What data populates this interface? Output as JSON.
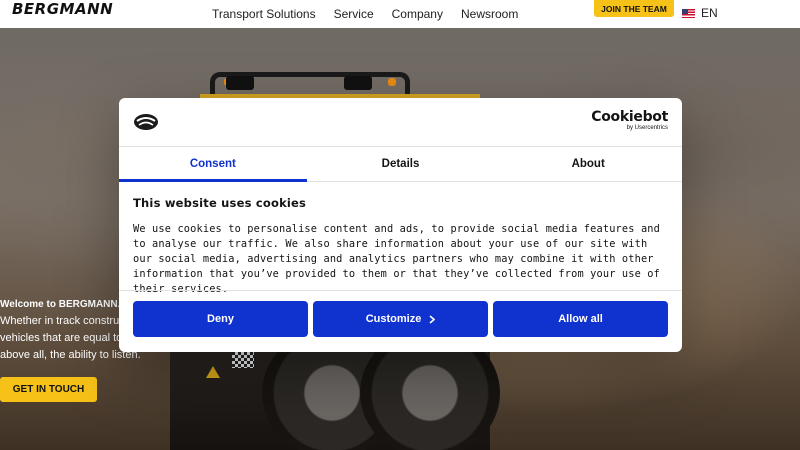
{
  "header": {
    "logo": "BERGMANN",
    "nav": [
      "Transport Solutions",
      "Service",
      "Company",
      "Newsroom"
    ],
    "join_label": "JOIN THE TEAM",
    "lang_label": "EN",
    "flag_icon": "us-flag-icon"
  },
  "hero": {
    "welcome": "Welcome to BERGMANN.",
    "line1": "Whether in track construc",
    "line2": "vehicles that are equal to",
    "line3": "above all, the ability to listen.",
    "cta_label": "GET IN TOUCH"
  },
  "cookie_dialog": {
    "brand_name": "Cookiebot",
    "brand_by": "by Usercentrics",
    "tabs": [
      "Consent",
      "Details",
      "About"
    ],
    "active_tab": "Consent",
    "title": "This website uses cookies",
    "text": "We use cookies to personalise content and ads, to provide social media features and to analyse our traffic. We also share information about your use of our site with our social media, advertising and analytics partners who may combine it with other information that you’ve provided to them or that they’ve collected from your use of their services.",
    "buttons": {
      "deny": "Deny",
      "customize": "Customize",
      "allow": "Allow all"
    }
  },
  "colors": {
    "accent_yellow": "#f6c218",
    "cookiebot_blue": "#1032cf"
  }
}
